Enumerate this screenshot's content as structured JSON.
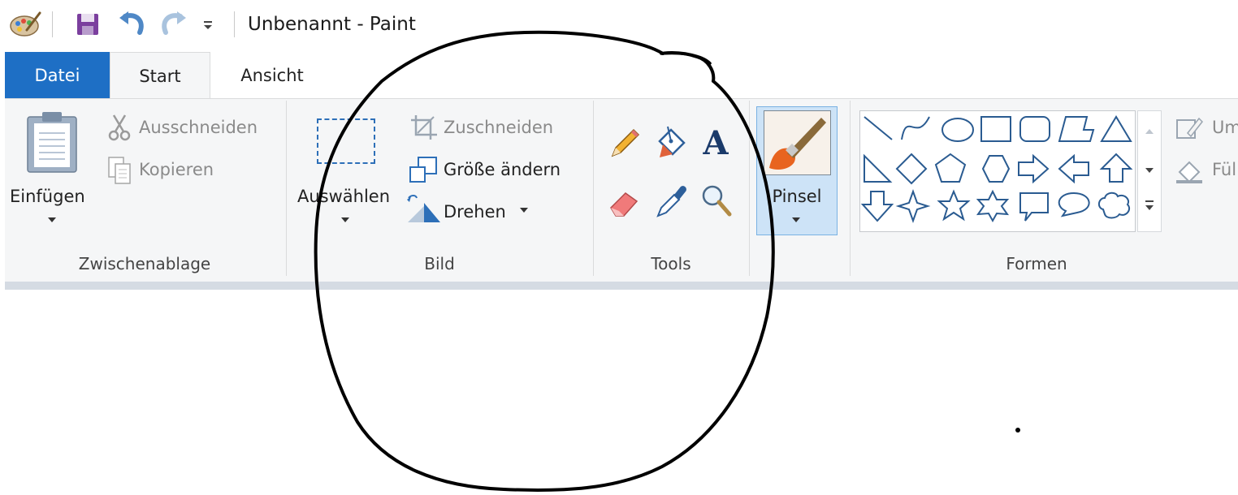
{
  "window": {
    "title": "Unbenannt - Paint"
  },
  "quick_access": {
    "app_icon": "paint-palette-icon",
    "save_icon": "save-icon",
    "undo_icon": "undo-icon",
    "redo_icon": "redo-icon",
    "customize_icon": "customize-qat-icon"
  },
  "tabs": [
    {
      "label": "Datei"
    },
    {
      "label": "Start"
    },
    {
      "label": "Ansicht"
    }
  ],
  "clipboard": {
    "paste_label": "Einfügen",
    "cut_label": "Ausschneiden",
    "copy_label": "Kopieren",
    "group_label": "Zwischenablage"
  },
  "image": {
    "select_label": "Auswählen",
    "crop_label": "Zuschneiden",
    "resize_label": "Größe ändern",
    "rotate_label": "Drehen",
    "group_label": "Bild"
  },
  "tools": {
    "group_label": "Tools",
    "items": [
      "pencil-icon",
      "fill-bucket-icon",
      "text-icon",
      "eraser-icon",
      "color-picker-icon",
      "magnifier-icon"
    ]
  },
  "brushes": {
    "label": "Pinsel"
  },
  "shapes": {
    "group_label": "Formen",
    "outline_label": "Um",
    "fill_label": "Fül",
    "items": [
      "line",
      "curve",
      "oval",
      "rectangle",
      "rounded-rectangle",
      "polygon",
      "triangle",
      "right-triangle",
      "diamond",
      "pentagon",
      "hexagon",
      "right-arrow",
      "left-arrow",
      "up-arrow",
      "down-arrow",
      "four-point-star",
      "five-point-star",
      "six-point-star",
      "rect-callout",
      "oval-callout",
      "cloud-callout"
    ]
  },
  "colors": {
    "file_tab": "#1e6fc5",
    "ribbon_bg": "#f5f6f7",
    "selected_tool_bg": "#cde3f7",
    "shape_stroke": "#2a5b91",
    "annotation": "#000000"
  }
}
